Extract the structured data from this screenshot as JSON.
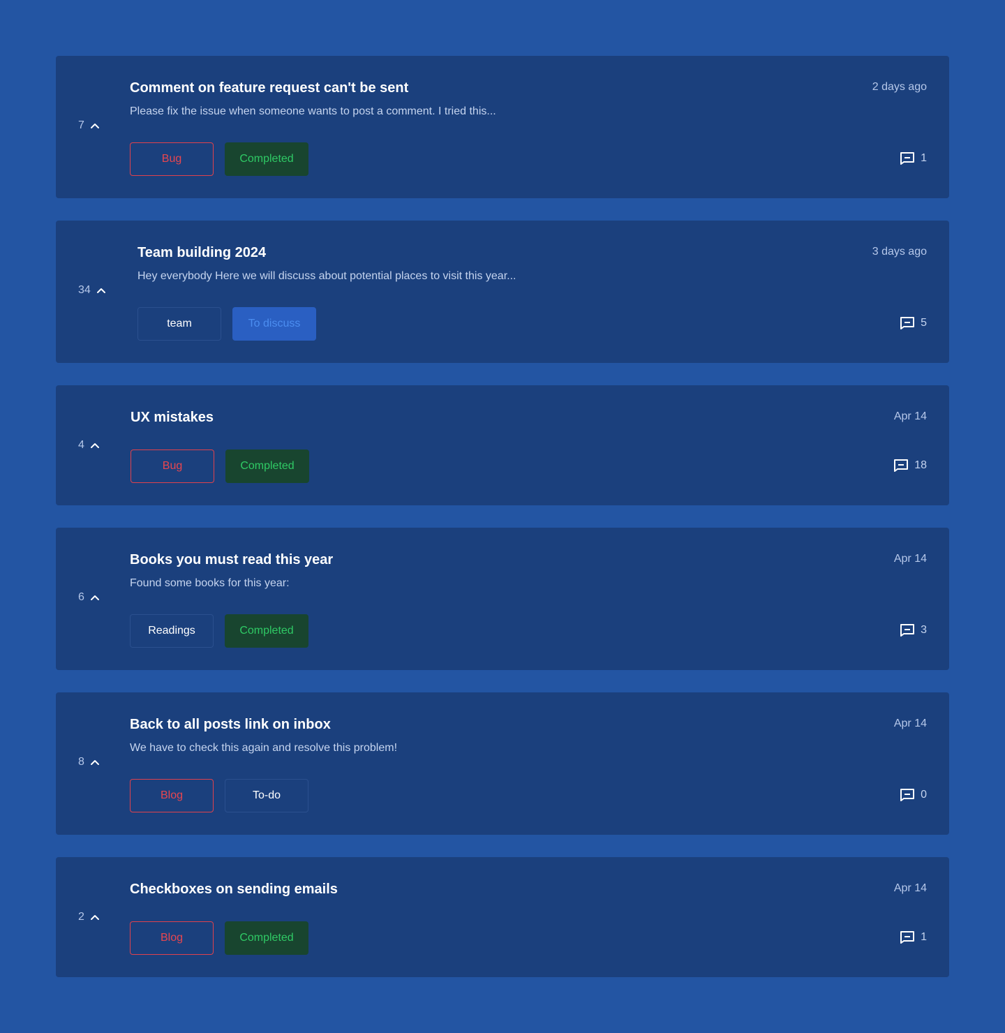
{
  "posts": [
    {
      "votes": "7",
      "title": "Comment on feature request can't be sent",
      "excerpt": "Please fix the issue when someone wants to post a comment. I tried this...",
      "date": "2 days ago",
      "comments": "1",
      "tags": [
        {
          "label": "Bug",
          "style": "red"
        },
        {
          "label": "Completed",
          "style": "green"
        }
      ]
    },
    {
      "votes": "34",
      "title": "Team building 2024",
      "excerpt": "Hey everybody Here we will discuss about potential places to visit this year...",
      "date": "3 days ago",
      "comments": "5",
      "tags": [
        {
          "label": "team",
          "style": "outline"
        },
        {
          "label": "To discuss",
          "style": "blue"
        }
      ]
    },
    {
      "votes": "4",
      "title": "UX mistakes",
      "excerpt": "",
      "date": "Apr 14",
      "comments": "18",
      "tags": [
        {
          "label": "Bug",
          "style": "red"
        },
        {
          "label": "Completed",
          "style": "green"
        }
      ]
    },
    {
      "votes": "6",
      "title": "Books you must read this year",
      "excerpt": "Found some books for this year:",
      "date": "Apr 14",
      "comments": "3",
      "tags": [
        {
          "label": "Readings",
          "style": "outline"
        },
        {
          "label": "Completed",
          "style": "green"
        }
      ]
    },
    {
      "votes": "8",
      "title": "Back to all posts link on inbox",
      "excerpt": "We have to check this again and resolve this problem!",
      "date": "Apr 14",
      "comments": "0",
      "tags": [
        {
          "label": "Blog",
          "style": "red"
        },
        {
          "label": "To-do",
          "style": "outline"
        }
      ]
    },
    {
      "votes": "2",
      "title": "Checkboxes on sending emails",
      "excerpt": "",
      "date": "Apr 14",
      "comments": "1",
      "tags": [
        {
          "label": "Blog",
          "style": "red"
        },
        {
          "label": "Completed",
          "style": "green"
        }
      ]
    }
  ],
  "icons": {
    "upvote": "chevron-up-icon",
    "comments": "comment-icon"
  },
  "colors": {
    "background": "#2355a3",
    "card": "#1b407d",
    "tag_red": "#e8464f",
    "tag_green_text": "#2fca65",
    "tag_green_bg": "#18452f",
    "tag_blue_text": "#4b8df0",
    "tag_blue_bg": "#2a5fc2"
  }
}
